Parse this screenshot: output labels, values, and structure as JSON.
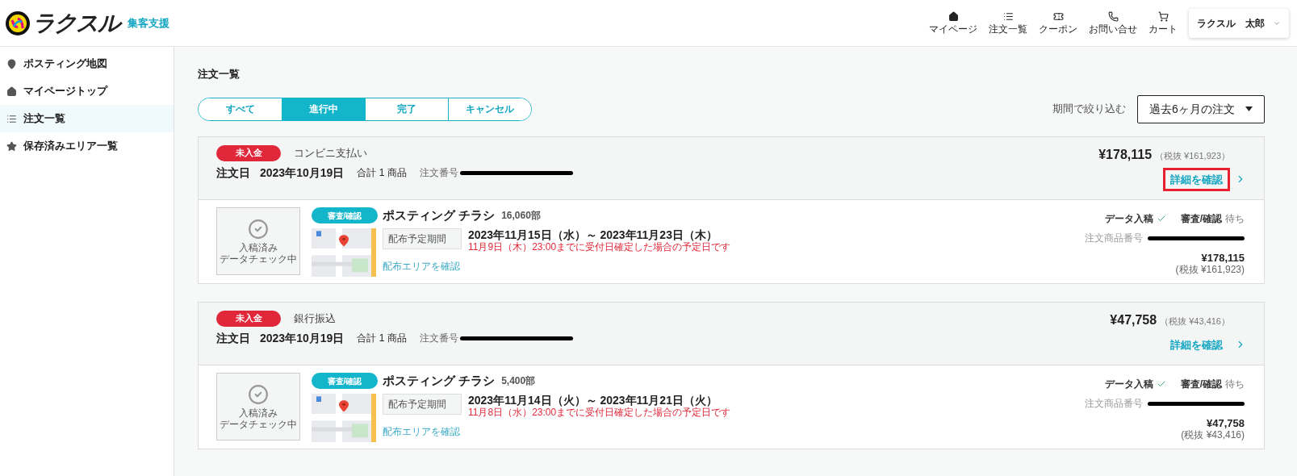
{
  "header": {
    "logo_text": "ラクスル",
    "service": "集客支援",
    "nav": [
      {
        "label": "マイページ",
        "kind": "home"
      },
      {
        "label": "注文一覧",
        "kind": "list"
      },
      {
        "label": "クーポン",
        "kind": "coupon"
      },
      {
        "label": "お問い合せ",
        "kind": "phone"
      },
      {
        "label": "カート",
        "kind": "cart"
      }
    ],
    "user": "ラクスル　太郎"
  },
  "sidebar": {
    "items": [
      {
        "label": "ポスティング地図",
        "kind": "pin",
        "selected": false
      },
      {
        "label": "マイページトップ",
        "kind": "home",
        "selected": false
      },
      {
        "label": "注文一覧",
        "kind": "list",
        "selected": true
      },
      {
        "label": "保存済みエリア一覧",
        "kind": "star",
        "selected": false
      }
    ]
  },
  "page_title": "注文一覧",
  "tabs": [
    {
      "label": "すべて",
      "selected": false
    },
    {
      "label": "進行中",
      "selected": true
    },
    {
      "label": "完了",
      "selected": false
    },
    {
      "label": "キャンセル",
      "selected": false
    }
  ],
  "filter": {
    "label": "期間で絞り込む",
    "value": "過去6ヶ月の注文"
  },
  "orders": [
    {
      "payment_status": "未入金",
      "payment_method": "コンビニ支払い",
      "date_label": "注文日",
      "date": "2023年10月19日",
      "count": "合計 1 商品",
      "order_no_label": "注文番号",
      "total": "¥178,115",
      "total_ex_tax": "（税抜 ¥161,923）",
      "detail_link": "詳細を確認",
      "highlighted": true,
      "item": {
        "status_title": "入稿済み",
        "status_sub": "データチェック中",
        "badge": "審査/確認",
        "name": "ポスティング チラシ",
        "qty": "16,060部",
        "period_label": "配布予定期間",
        "period": "2023年11月15日（水）～ 2023年11月23日（木）",
        "note": "11月9日（木）23:00までに受付日確定した場合の予定日です",
        "area_link": "配布エリアを確認",
        "steps": [
          {
            "label": "データ入稿",
            "done": true
          },
          {
            "label": "審査/確認",
            "done": false,
            "note": "待ち"
          }
        ],
        "item_no_label": "注文商品番号",
        "price": "¥178,115",
        "price_ex_tax": "(税抜 ¥161,923)"
      }
    },
    {
      "payment_status": "未入金",
      "payment_method": "銀行振込",
      "date_label": "注文日",
      "date": "2023年10月19日",
      "count": "合計 1 商品",
      "order_no_label": "注文番号",
      "total": "¥47,758",
      "total_ex_tax": "（税抜 ¥43,416）",
      "detail_link": "詳細を確認",
      "highlighted": false,
      "item": {
        "status_title": "入稿済み",
        "status_sub": "データチェック中",
        "badge": "審査/確認",
        "name": "ポスティング チラシ",
        "qty": "5,400部",
        "period_label": "配布予定期間",
        "period": "2023年11月14日（火）～ 2023年11月21日（火）",
        "note": "11月8日（水）23:00までに受付日確定した場合の予定日です",
        "area_link": "配布エリアを確認",
        "steps": [
          {
            "label": "データ入稿",
            "done": true
          },
          {
            "label": "審査/確認",
            "done": false,
            "note": "待ち"
          }
        ],
        "item_no_label": "注文商品番号",
        "price": "¥47,758",
        "price_ex_tax": "(税抜 ¥43,416)"
      }
    }
  ]
}
